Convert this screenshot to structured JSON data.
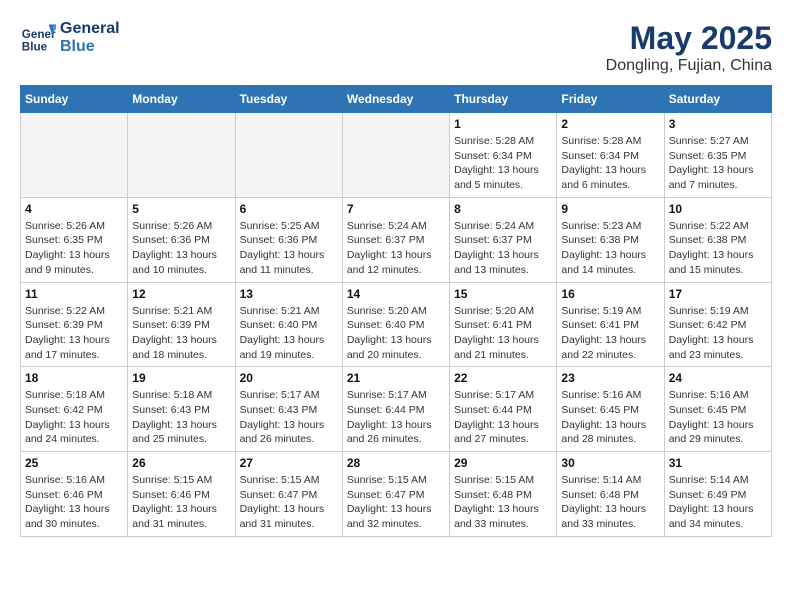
{
  "header": {
    "logo_line1": "General",
    "logo_line2": "Blue",
    "title": "May 2025",
    "subtitle": "Dongling, Fujian, China"
  },
  "calendar": {
    "days_of_week": [
      "Sunday",
      "Monday",
      "Tuesday",
      "Wednesday",
      "Thursday",
      "Friday",
      "Saturday"
    ],
    "weeks": [
      [
        {
          "day": "",
          "info": ""
        },
        {
          "day": "",
          "info": ""
        },
        {
          "day": "",
          "info": ""
        },
        {
          "day": "",
          "info": ""
        },
        {
          "day": "1",
          "info": "Sunrise: 5:28 AM\nSunset: 6:34 PM\nDaylight: 13 hours\nand 5 minutes."
        },
        {
          "day": "2",
          "info": "Sunrise: 5:28 AM\nSunset: 6:34 PM\nDaylight: 13 hours\nand 6 minutes."
        },
        {
          "day": "3",
          "info": "Sunrise: 5:27 AM\nSunset: 6:35 PM\nDaylight: 13 hours\nand 7 minutes."
        }
      ],
      [
        {
          "day": "4",
          "info": "Sunrise: 5:26 AM\nSunset: 6:35 PM\nDaylight: 13 hours\nand 9 minutes."
        },
        {
          "day": "5",
          "info": "Sunrise: 5:26 AM\nSunset: 6:36 PM\nDaylight: 13 hours\nand 10 minutes."
        },
        {
          "day": "6",
          "info": "Sunrise: 5:25 AM\nSunset: 6:36 PM\nDaylight: 13 hours\nand 11 minutes."
        },
        {
          "day": "7",
          "info": "Sunrise: 5:24 AM\nSunset: 6:37 PM\nDaylight: 13 hours\nand 12 minutes."
        },
        {
          "day": "8",
          "info": "Sunrise: 5:24 AM\nSunset: 6:37 PM\nDaylight: 13 hours\nand 13 minutes."
        },
        {
          "day": "9",
          "info": "Sunrise: 5:23 AM\nSunset: 6:38 PM\nDaylight: 13 hours\nand 14 minutes."
        },
        {
          "day": "10",
          "info": "Sunrise: 5:22 AM\nSunset: 6:38 PM\nDaylight: 13 hours\nand 15 minutes."
        }
      ],
      [
        {
          "day": "11",
          "info": "Sunrise: 5:22 AM\nSunset: 6:39 PM\nDaylight: 13 hours\nand 17 minutes."
        },
        {
          "day": "12",
          "info": "Sunrise: 5:21 AM\nSunset: 6:39 PM\nDaylight: 13 hours\nand 18 minutes."
        },
        {
          "day": "13",
          "info": "Sunrise: 5:21 AM\nSunset: 6:40 PM\nDaylight: 13 hours\nand 19 minutes."
        },
        {
          "day": "14",
          "info": "Sunrise: 5:20 AM\nSunset: 6:40 PM\nDaylight: 13 hours\nand 20 minutes."
        },
        {
          "day": "15",
          "info": "Sunrise: 5:20 AM\nSunset: 6:41 PM\nDaylight: 13 hours\nand 21 minutes."
        },
        {
          "day": "16",
          "info": "Sunrise: 5:19 AM\nSunset: 6:41 PM\nDaylight: 13 hours\nand 22 minutes."
        },
        {
          "day": "17",
          "info": "Sunrise: 5:19 AM\nSunset: 6:42 PM\nDaylight: 13 hours\nand 23 minutes."
        }
      ],
      [
        {
          "day": "18",
          "info": "Sunrise: 5:18 AM\nSunset: 6:42 PM\nDaylight: 13 hours\nand 24 minutes."
        },
        {
          "day": "19",
          "info": "Sunrise: 5:18 AM\nSunset: 6:43 PM\nDaylight: 13 hours\nand 25 minutes."
        },
        {
          "day": "20",
          "info": "Sunrise: 5:17 AM\nSunset: 6:43 PM\nDaylight: 13 hours\nand 26 minutes."
        },
        {
          "day": "21",
          "info": "Sunrise: 5:17 AM\nSunset: 6:44 PM\nDaylight: 13 hours\nand 26 minutes."
        },
        {
          "day": "22",
          "info": "Sunrise: 5:17 AM\nSunset: 6:44 PM\nDaylight: 13 hours\nand 27 minutes."
        },
        {
          "day": "23",
          "info": "Sunrise: 5:16 AM\nSunset: 6:45 PM\nDaylight: 13 hours\nand 28 minutes."
        },
        {
          "day": "24",
          "info": "Sunrise: 5:16 AM\nSunset: 6:45 PM\nDaylight: 13 hours\nand 29 minutes."
        }
      ],
      [
        {
          "day": "25",
          "info": "Sunrise: 5:16 AM\nSunset: 6:46 PM\nDaylight: 13 hours\nand 30 minutes."
        },
        {
          "day": "26",
          "info": "Sunrise: 5:15 AM\nSunset: 6:46 PM\nDaylight: 13 hours\nand 31 minutes."
        },
        {
          "day": "27",
          "info": "Sunrise: 5:15 AM\nSunset: 6:47 PM\nDaylight: 13 hours\nand 31 minutes."
        },
        {
          "day": "28",
          "info": "Sunrise: 5:15 AM\nSunset: 6:47 PM\nDaylight: 13 hours\nand 32 minutes."
        },
        {
          "day": "29",
          "info": "Sunrise: 5:15 AM\nSunset: 6:48 PM\nDaylight: 13 hours\nand 33 minutes."
        },
        {
          "day": "30",
          "info": "Sunrise: 5:14 AM\nSunset: 6:48 PM\nDaylight: 13 hours\nand 33 minutes."
        },
        {
          "day": "31",
          "info": "Sunrise: 5:14 AM\nSunset: 6:49 PM\nDaylight: 13 hours\nand 34 minutes."
        }
      ]
    ]
  }
}
